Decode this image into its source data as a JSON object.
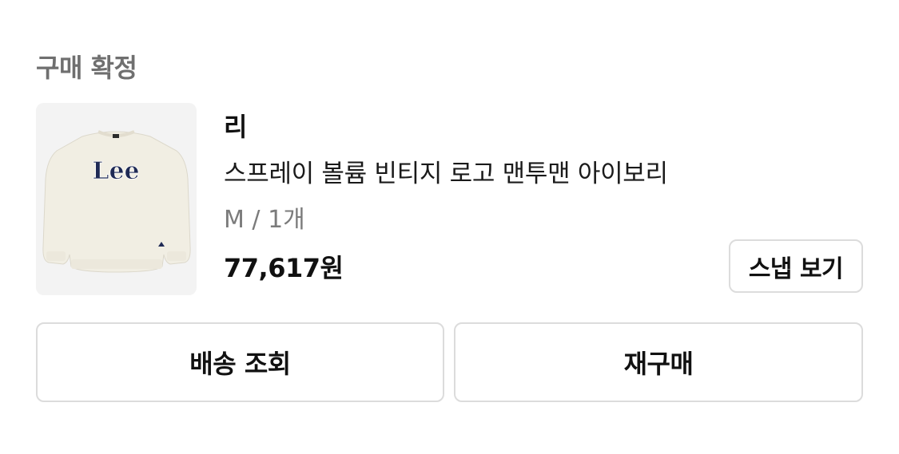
{
  "order": {
    "status": "구매 확정",
    "product": {
      "image_alt": "sweatshirt-product-image",
      "brand": "리",
      "name": "스프레이 볼륨 빈티지 로고 맨투맨 아이보리",
      "option": "M / 1개",
      "price": "77,617원"
    },
    "snap_button": "스냅 보기",
    "actions": {
      "track_shipping": "배송 조회",
      "repurchase": "재구매"
    }
  },
  "colors": {
    "thumb_bg": "#f3f3f3",
    "border": "#dcdcdc",
    "muted_text": "#6f6f6f",
    "logo_navy": "#1f2a55"
  }
}
